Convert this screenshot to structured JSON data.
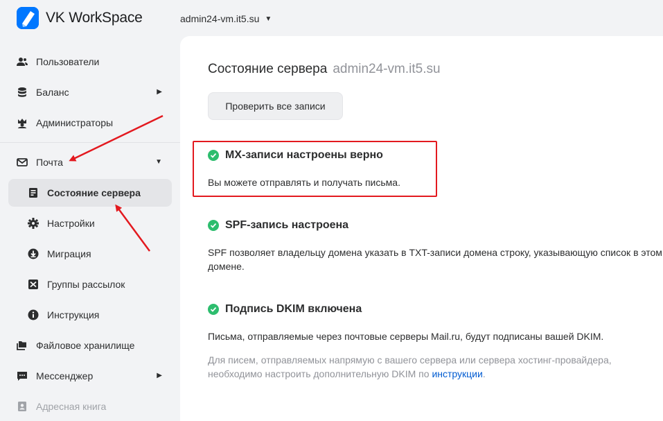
{
  "header": {
    "brand": "VK WorkSpace",
    "domain": "admin24-vm.it5.su"
  },
  "sidebar": {
    "items": [
      {
        "label": "Пользователи",
        "icon": "users-icon"
      },
      {
        "label": "Баланс",
        "icon": "coins-icon"
      },
      {
        "label": "Администраторы",
        "icon": "admin-icon"
      },
      {
        "label": "Почта",
        "icon": "mail-icon"
      },
      {
        "label": "Состояние сервера",
        "icon": "server-status-icon"
      },
      {
        "label": "Настройки",
        "icon": "gear-icon"
      },
      {
        "label": "Миграция",
        "icon": "download-icon"
      },
      {
        "label": "Группы рассылок",
        "icon": "mailing-group-icon"
      },
      {
        "label": "Инструкция",
        "icon": "info-icon"
      },
      {
        "label": "Файловое хранилище",
        "icon": "folder-icon"
      },
      {
        "label": "Мессенджер",
        "icon": "chat-icon"
      },
      {
        "label": "Адресная книга",
        "icon": "address-book-icon"
      }
    ]
  },
  "main": {
    "title": "Состояние сервера",
    "title_domain": "admin24-vm.it5.su",
    "check_button": "Проверить все записи",
    "sections": [
      {
        "title": "MX-записи настроены верно",
        "text": "Вы можете отправлять и получать письма."
      },
      {
        "title": "SPF-запись настроена",
        "text": "SPF позволяет владельцу домена указать в TXT-записи домена строку, указывающую список в этом домене."
      },
      {
        "title": "Подпись DKIM включена",
        "text": "Письма, отправляемые через почтовые серверы Mail.ru, будут подписаны вашей DKIM.",
        "note": "Для писем, отправляемых напрямую с вашего сервера или сервера хостинг-провайдера, необходимо настроить дополнительную DKIM по ",
        "link": "инструкции",
        "note_end": "."
      }
    ]
  },
  "colors": {
    "accent": "#0077ff",
    "success": "#2dbd6e",
    "annotation": "#e3191f",
    "link": "#005bd1"
  }
}
